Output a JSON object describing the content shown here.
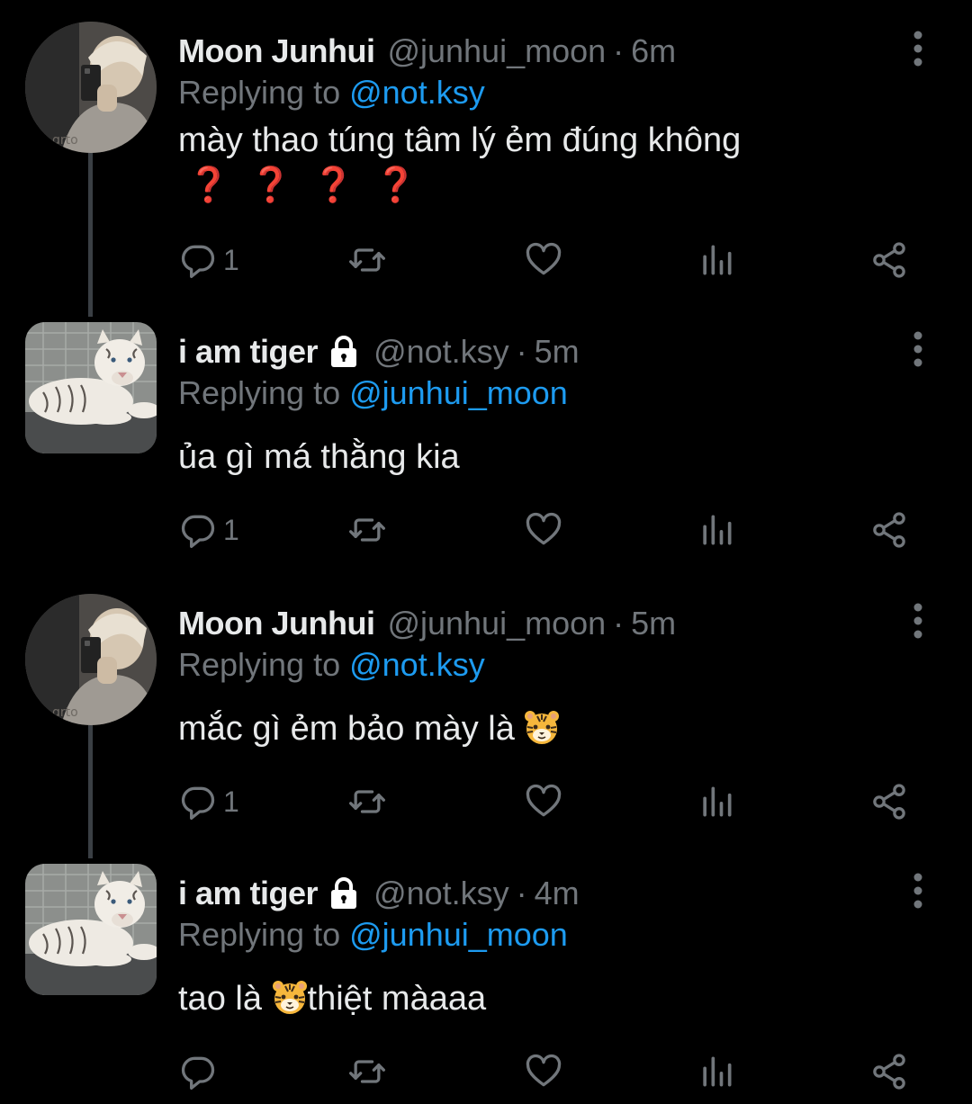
{
  "tweets": [
    {
      "name": "Moon Junhui",
      "handle": "@junhui_moon",
      "separator": "·",
      "time": "6m",
      "locked": false,
      "replying_prefix": "Replying to ",
      "replying_to": "@not.ksy",
      "text": "mày thao túng tâm lý ẻm đúng không",
      "text_line2": "❓❓❓❓",
      "reply_count": "1",
      "avatar": "person-photo"
    },
    {
      "name": "i am tiger",
      "handle": "@not.ksy",
      "separator": "·",
      "time": "5m",
      "locked": true,
      "replying_prefix": "Replying to ",
      "replying_to": "@junhui_moon",
      "text": "ủa gì má thằng kia",
      "reply_count": "1",
      "avatar": "white-tiger-photo"
    },
    {
      "name": "Moon Junhui",
      "handle": "@junhui_moon",
      "separator": "·",
      "time": "5m",
      "locked": false,
      "replying_prefix": "Replying to ",
      "replying_to": "@not.ksy",
      "text": "mắc gì ẻm bảo mày là",
      "text_emoji": "tiger-face-emoji",
      "reply_count": "1",
      "avatar": "person-photo"
    },
    {
      "name": "i am tiger",
      "handle": "@not.ksy",
      "separator": "·",
      "time": "4m",
      "locked": true,
      "replying_prefix": "Replying to ",
      "replying_to": "@junhui_moon",
      "text_before": "tao là",
      "text_emoji": "tiger-face-emoji",
      "text_after": "thiệt màaaa",
      "reply_count": "",
      "avatar": "white-tiger-photo"
    }
  ],
  "icons": {
    "reply": "reply-icon",
    "retweet": "retweet-icon",
    "like": "heart-icon",
    "views": "views-icon",
    "share": "share-icon",
    "more": "more-vertical-icon",
    "lock": "lock-icon"
  },
  "colors": {
    "background": "#000000",
    "text": "#e7e9ea",
    "muted": "#71767b",
    "mention": "#1d9bf0",
    "question_mark": "#d4101b"
  }
}
